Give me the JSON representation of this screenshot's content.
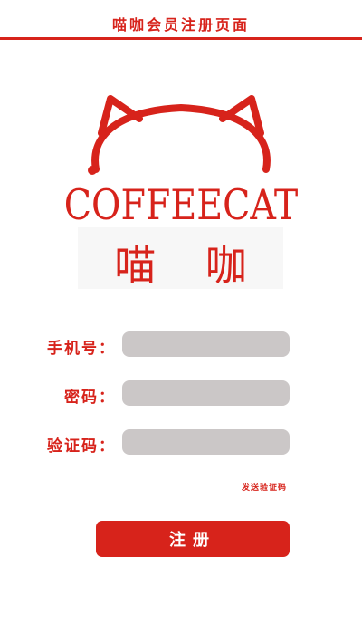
{
  "header": {
    "title": "喵咖会员注册页面"
  },
  "brand": {
    "name_en": "COFFEECAT",
    "name_cn": "喵 咖"
  },
  "form": {
    "phone": {
      "label": "手机号：",
      "value": "",
      "placeholder": ""
    },
    "password": {
      "label": "密码：",
      "value": "",
      "placeholder": ""
    },
    "code": {
      "label": "验证码：",
      "value": "",
      "placeholder": ""
    },
    "send_code_label": "发送验证码",
    "submit_label": "注册"
  },
  "colors": {
    "accent": "#d7231b",
    "input_bg": "#cbc7c7"
  },
  "icons": {
    "logo": "cat-ears-logo-icon"
  }
}
